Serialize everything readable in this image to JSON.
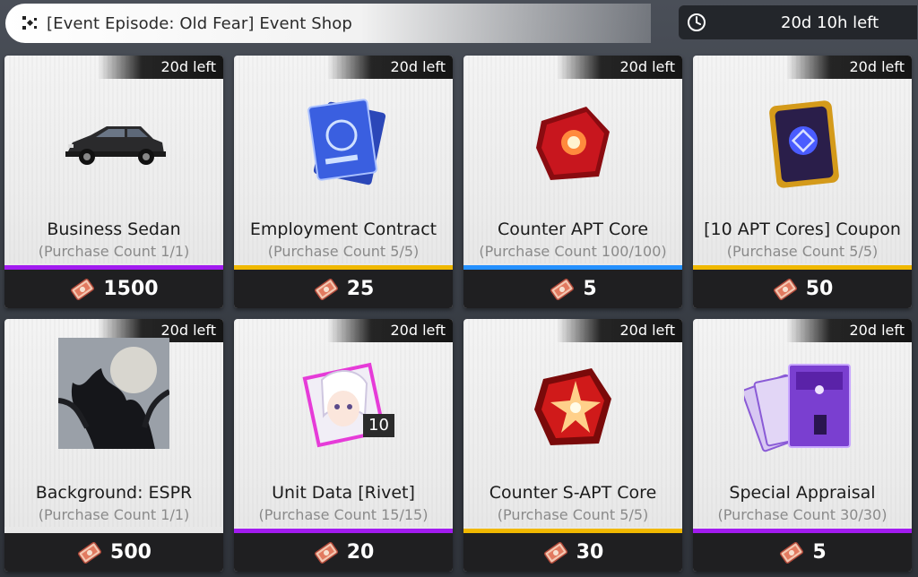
{
  "header": {
    "title": "[Event Episode: Old Fear] Event Shop",
    "timer": "20d 10h left"
  },
  "colors": {
    "purple": "#a21bf0",
    "yellow": "#f0b800",
    "blue": "#2490ff"
  },
  "items": [
    {
      "name": "Business Sedan",
      "time": "20d left",
      "count": "(Purchase Count 1/1)",
      "price": "1500",
      "rarity": "purple",
      "icon": "sedan-car-icon"
    },
    {
      "name": "Employment Contract",
      "time": "20d left",
      "count": "(Purchase Count 5/5)",
      "price": "25",
      "rarity": "yellow",
      "icon": "contract-icon"
    },
    {
      "name": "Counter APT Core",
      "time": "20d left",
      "count": "(Purchase Count 100/100)",
      "price": "5",
      "rarity": "blue",
      "icon": "apt-core-icon"
    },
    {
      "name": "[10 APT Cores] Coupon",
      "time": "20d left",
      "count": "(Purchase Count 5/5)",
      "price": "50",
      "rarity": "yellow",
      "icon": "coupon-icon"
    },
    {
      "name": "Background: ESPR",
      "time": "20d left",
      "count": "(Purchase Count 1/1)",
      "price": "500",
      "rarity": "none",
      "icon": "background-espr-icon"
    },
    {
      "name": "Unit Data [Rivet]",
      "time": "20d left",
      "count": "(Purchase Count 15/15)",
      "price": "20",
      "rarity": "purple",
      "icon": "unit-data-rivet-icon",
      "badge": "10"
    },
    {
      "name": "Counter S-APT Core",
      "time": "20d left",
      "count": "(Purchase Count 5/5)",
      "price": "30",
      "rarity": "yellow",
      "icon": "s-apt-core-icon"
    },
    {
      "name": "Special Appraisal",
      "time": "20d left",
      "count": "(Purchase Count 30/30)",
      "price": "5",
      "rarity": "purple",
      "icon": "special-appraisal-icon"
    }
  ]
}
